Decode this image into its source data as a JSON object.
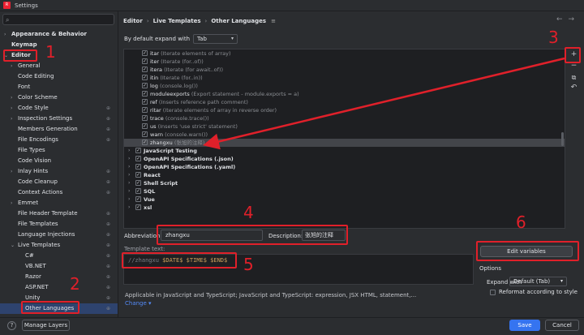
{
  "window": {
    "title": "Settings"
  },
  "sidebar": {
    "items": [
      {
        "label": "Appearance & Behavior",
        "level": 0,
        "arrow": "right",
        "bold": true
      },
      {
        "label": "Keymap",
        "level": 0,
        "arrow": "",
        "bold": true
      },
      {
        "label": "Editor",
        "level": 0,
        "arrow": "down",
        "bold": true
      },
      {
        "label": "General",
        "level": 1,
        "arrow": "right"
      },
      {
        "label": "Code Editing",
        "level": 1,
        "arrow": ""
      },
      {
        "label": "Font",
        "level": 1,
        "arrow": ""
      },
      {
        "label": "Color Scheme",
        "level": 1,
        "arrow": "right"
      },
      {
        "label": "Code Style",
        "level": 1,
        "arrow": "right",
        "gear": true
      },
      {
        "label": "Inspection Settings",
        "level": 1,
        "arrow": "right",
        "gear": true
      },
      {
        "label": "Members Generation",
        "level": 1,
        "arrow": "",
        "gear": true
      },
      {
        "label": "File Encodings",
        "level": 1,
        "arrow": "",
        "gear": true
      },
      {
        "label": "File Types",
        "level": 1,
        "arrow": ""
      },
      {
        "label": "Code Vision",
        "level": 1,
        "arrow": ""
      },
      {
        "label": "Inlay Hints",
        "level": 1,
        "arrow": "right",
        "gear": true
      },
      {
        "label": "Code Cleanup",
        "level": 1,
        "arrow": "",
        "gear": true
      },
      {
        "label": "Context Actions",
        "level": 1,
        "arrow": "",
        "gear": true
      },
      {
        "label": "Emmet",
        "level": 1,
        "arrow": "right"
      },
      {
        "label": "File Header Template",
        "level": 1,
        "arrow": "",
        "gear": true
      },
      {
        "label": "File Templates",
        "level": 1,
        "arrow": "",
        "gear": true
      },
      {
        "label": "Language Injections",
        "level": 1,
        "arrow": "",
        "gear": true
      },
      {
        "label": "Live Templates",
        "level": 1,
        "arrow": "down",
        "gear": true
      },
      {
        "label": "C#",
        "level": 2,
        "arrow": "",
        "gear": true
      },
      {
        "label": "VB.NET",
        "level": 2,
        "arrow": "",
        "gear": true
      },
      {
        "label": "Razor",
        "level": 2,
        "arrow": "",
        "gear": true
      },
      {
        "label": "ASP.NET",
        "level": 2,
        "arrow": "",
        "gear": true
      },
      {
        "label": "Unity",
        "level": 2,
        "arrow": "",
        "gear": true
      },
      {
        "label": "Other Languages",
        "level": 2,
        "arrow": "",
        "gear": true,
        "selected": true
      }
    ]
  },
  "breadcrumb": {
    "items": [
      "Editor",
      "Live Templates",
      "Other Languages"
    ],
    "icon": "≡"
  },
  "expand": {
    "label": "By default expand with",
    "value": "Tab"
  },
  "templates": {
    "rows": [
      {
        "kind": "item",
        "abbr": "itar",
        "desc": "(Iterate elements of array)"
      },
      {
        "kind": "item",
        "abbr": "iter",
        "desc": "(Iterate (for..of))"
      },
      {
        "kind": "item",
        "abbr": "itera",
        "desc": "(Iterate (for await..of))"
      },
      {
        "kind": "item",
        "abbr": "itin",
        "desc": "(Iterate (for..in))"
      },
      {
        "kind": "item",
        "abbr": "log",
        "desc": "(console.log())"
      },
      {
        "kind": "item",
        "abbr": "moduleexports",
        "desc": "(Export statement - module.exports = a)"
      },
      {
        "kind": "item",
        "abbr": "ref",
        "desc": "(Inserts reference path comment)"
      },
      {
        "kind": "item",
        "abbr": "ritar",
        "desc": "(Iterate elements of array in reverse order)"
      },
      {
        "kind": "item",
        "abbr": "trace",
        "desc": "(console.trace())"
      },
      {
        "kind": "item",
        "abbr": "us",
        "desc": "(Inserts 'use strict' statement)"
      },
      {
        "kind": "item",
        "abbr": "warn",
        "desc": "(console.warn())"
      },
      {
        "kind": "item",
        "abbr": "zhangxu",
        "desc": "(张旭的注释)",
        "highlight": true
      },
      {
        "kind": "group",
        "abbr": "JavaScript Testing"
      },
      {
        "kind": "group",
        "abbr": "OpenAPI Specifications (.json)"
      },
      {
        "kind": "group",
        "abbr": "OpenAPI Specifications (.yaml)"
      },
      {
        "kind": "group",
        "abbr": "React"
      },
      {
        "kind": "group",
        "abbr": "Shell Script"
      },
      {
        "kind": "group",
        "abbr": "SQL"
      },
      {
        "kind": "group",
        "abbr": "Vue"
      },
      {
        "kind": "group",
        "abbr": "xsl"
      }
    ]
  },
  "tools": {
    "add": "+",
    "remove": "−",
    "copy": "⧉",
    "revert": "↶"
  },
  "editor": {
    "abbr_label": "Abbreviation:",
    "abbr_value": "zhangxu",
    "desc_label": "Description:",
    "desc_value": "张旭的注释",
    "template_label": "Template text:",
    "template_comment": "//zhangxu",
    "template_vars": "$DATE$ $TIME$ $END$",
    "edit_vars": "Edit variables",
    "options_label": "Options",
    "expand_with_label": "Expand with",
    "expand_with_value": "Default (Tab)",
    "reformat_label": "Reformat according to style",
    "applicable": "Applicable in JavaScript and TypeScript; JavaScript and TypeScript: expression, JSX HTML, statement,...",
    "change": "Change ▾"
  },
  "footer": {
    "help": "?",
    "manage_layers": "Manage Layers",
    "save": "Save",
    "cancel": "Cancel"
  },
  "annotations": {
    "numbers": [
      "1",
      "2",
      "3",
      "4",
      "5",
      "6"
    ],
    "color": "#e0202a"
  },
  "colors": {
    "accent": "#3574f0",
    "selection": "#2e436e",
    "annotation": "#e0202a"
  }
}
